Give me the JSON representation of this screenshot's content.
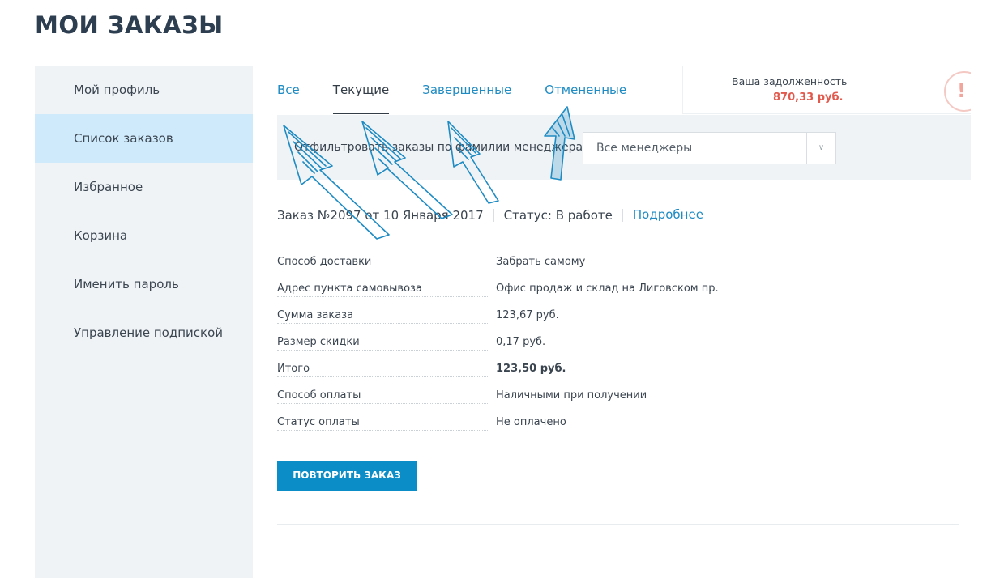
{
  "page": {
    "title": "МОИ ЗАКАЗЫ"
  },
  "sidebar": {
    "items": [
      {
        "label": "Мой профиль"
      },
      {
        "label": "Список заказов"
      },
      {
        "label": "Избранное"
      },
      {
        "label": "Корзина"
      },
      {
        "label": "Именить пароль"
      },
      {
        "label": "Управление подпиской"
      }
    ],
    "active_index": 1
  },
  "tabs": {
    "items": [
      {
        "label": "Все"
      },
      {
        "label": "Текущие"
      },
      {
        "label": "Завершенные"
      },
      {
        "label": "Отмененные"
      }
    ],
    "active_index": 1
  },
  "debt": {
    "label": "Ваша задолженность",
    "value": "870,33 руб.",
    "icon": "exclamation-icon"
  },
  "filter": {
    "label": "Отфильтровать заказы по фамилии менеджера",
    "select_value": "Все менеджеры"
  },
  "order": {
    "title": "Заказ №2097 от 10 Января 2017",
    "status": "Статус: В работе",
    "more_link": "Подробнее",
    "details": [
      {
        "key": "Способ доставки",
        "value": "Забрать самому"
      },
      {
        "key": "Адрес пункта самовывоза",
        "value": "Офис продаж и склад на Лиговском пр."
      },
      {
        "key": "Сумма заказа",
        "value": "123,67 руб."
      },
      {
        "key": "Размер скидки",
        "value": "0,17 руб."
      },
      {
        "key": "Итого",
        "value": "123,50 руб."
      },
      {
        "key": "Способ оплаты",
        "value": "Наличными при получении"
      },
      {
        "key": "Статус оплаты",
        "value": "Не оплачено"
      }
    ],
    "repeat_button": "ПОВТОРИТЬ ЗАКАЗ"
  },
  "colors": {
    "accent": "#1e8bc3",
    "button": "#0b8ec7",
    "debt": "#e15a4d",
    "sidebar_bg": "#eff3f6",
    "sidebar_active": "#cfeafb"
  }
}
